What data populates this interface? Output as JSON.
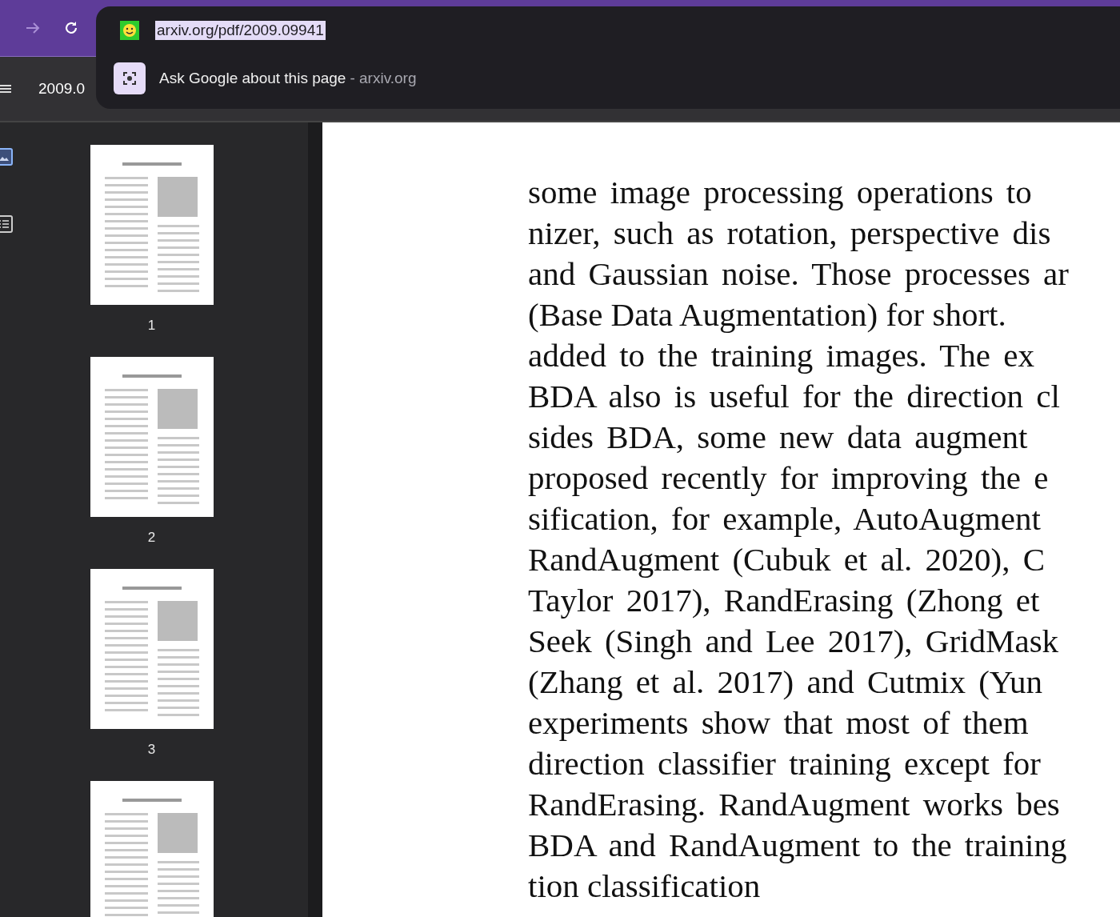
{
  "browser": {
    "url": "arxiv.org/pdf/2009.09941",
    "url_selected": true,
    "suggestion": {
      "text": "Ask Google about this page",
      "source": "- arxiv.org"
    }
  },
  "viewer": {
    "title": "2009.0"
  },
  "sidebar_tabs": [
    {
      "kind": "thumbnails",
      "selected": true
    },
    {
      "kind": "outline",
      "selected": false
    }
  ],
  "thumbnails": [
    {
      "page": "1"
    },
    {
      "page": "2"
    },
    {
      "page": "3"
    }
  ],
  "more_thumbnails_below": true,
  "document_lines": [
    "some image processing operations to",
    "nizer, such as rotation, perspective dis",
    "and Gaussian noise. Those processes ar",
    "(Base Data Augmentation) for short.",
    "added to the training images. The ex",
    "BDA also is useful for the direction cl",
    "sides BDA, some new data augment",
    "proposed recently for improving the e",
    "sification, for example, AutoAugment",
    "RandAugment (Cubuk et al. 2020), C",
    "Taylor 2017), RandErasing (Zhong et",
    "Seek (Singh and Lee 2017), GridMask",
    "(Zhang et al. 2017) and Cutmix (Yun",
    "experiments show that most of them",
    "direction classifier training except for",
    "RandErasing. RandAugment works bes",
    "BDA and RandAugment to the training",
    "tion classification"
  ]
}
